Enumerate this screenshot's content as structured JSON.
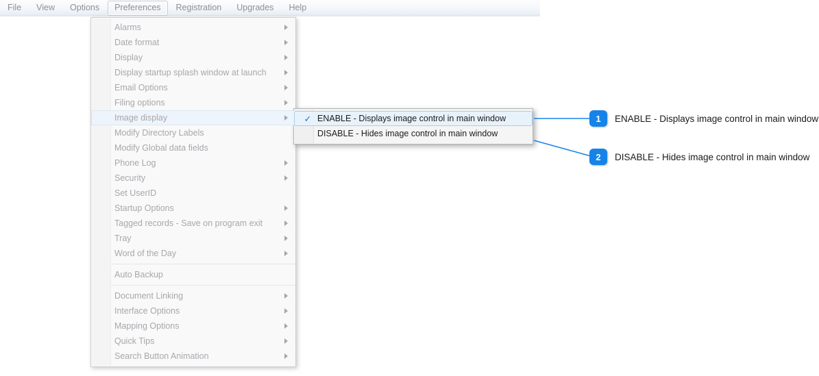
{
  "menubar": {
    "items": [
      {
        "label": "File",
        "active": false
      },
      {
        "label": "View",
        "active": false
      },
      {
        "label": "Options",
        "active": false
      },
      {
        "label": "Preferences",
        "active": true
      },
      {
        "label": "Registration",
        "active": false
      },
      {
        "label": "Upgrades",
        "active": false
      },
      {
        "label": "Help",
        "active": false
      }
    ]
  },
  "dropdown": {
    "items": [
      {
        "label": "Alarms",
        "arrow": true
      },
      {
        "label": "Date format",
        "arrow": true
      },
      {
        "label": "Display",
        "arrow": true
      },
      {
        "label": "Display startup splash window at launch",
        "arrow": true
      },
      {
        "label": "Email Options",
        "arrow": true
      },
      {
        "label": "Filing options",
        "arrow": true
      },
      {
        "label": "Image display",
        "arrow": true
      },
      {
        "label": "Modify Directory Labels",
        "arrow": false
      },
      {
        "label": "Modify Global data fields",
        "arrow": false
      },
      {
        "label": "Phone Log",
        "arrow": true
      },
      {
        "label": "Security",
        "arrow": true
      },
      {
        "label": "Set UserID",
        "arrow": false
      },
      {
        "label": "Startup Options",
        "arrow": true
      },
      {
        "label": "Tagged records - Save on program exit",
        "arrow": true
      },
      {
        "label": "Tray",
        "arrow": true
      },
      {
        "label": "Word of the Day",
        "arrow": true
      },
      {
        "label": "Auto Backup",
        "arrow": false
      },
      {
        "label": "Document Linking",
        "arrow": true
      },
      {
        "label": "Interface Options",
        "arrow": true
      },
      {
        "label": "Mapping Options",
        "arrow": true
      },
      {
        "label": "Quick Tips",
        "arrow": true
      },
      {
        "label": "Search Button Animation",
        "arrow": true
      }
    ]
  },
  "submenu": {
    "items": [
      {
        "label": "ENABLE - Displays image control in main window",
        "checked": true,
        "check_glyph": "✓"
      },
      {
        "label": "DISABLE - Hides image control in main window",
        "checked": false,
        "check_glyph": ""
      }
    ]
  },
  "callouts": [
    {
      "number": "1",
      "text": "ENABLE - Displays image control in main window"
    },
    {
      "number": "2",
      "text": "DISABLE - Hides image control in main window"
    }
  ],
  "colors": {
    "accent": "#1683e8",
    "connector": "#1683e8",
    "menu_text": "#a9a6ac",
    "submenu_text": "#1b1b1b",
    "highlight": "#e8f2fb"
  }
}
